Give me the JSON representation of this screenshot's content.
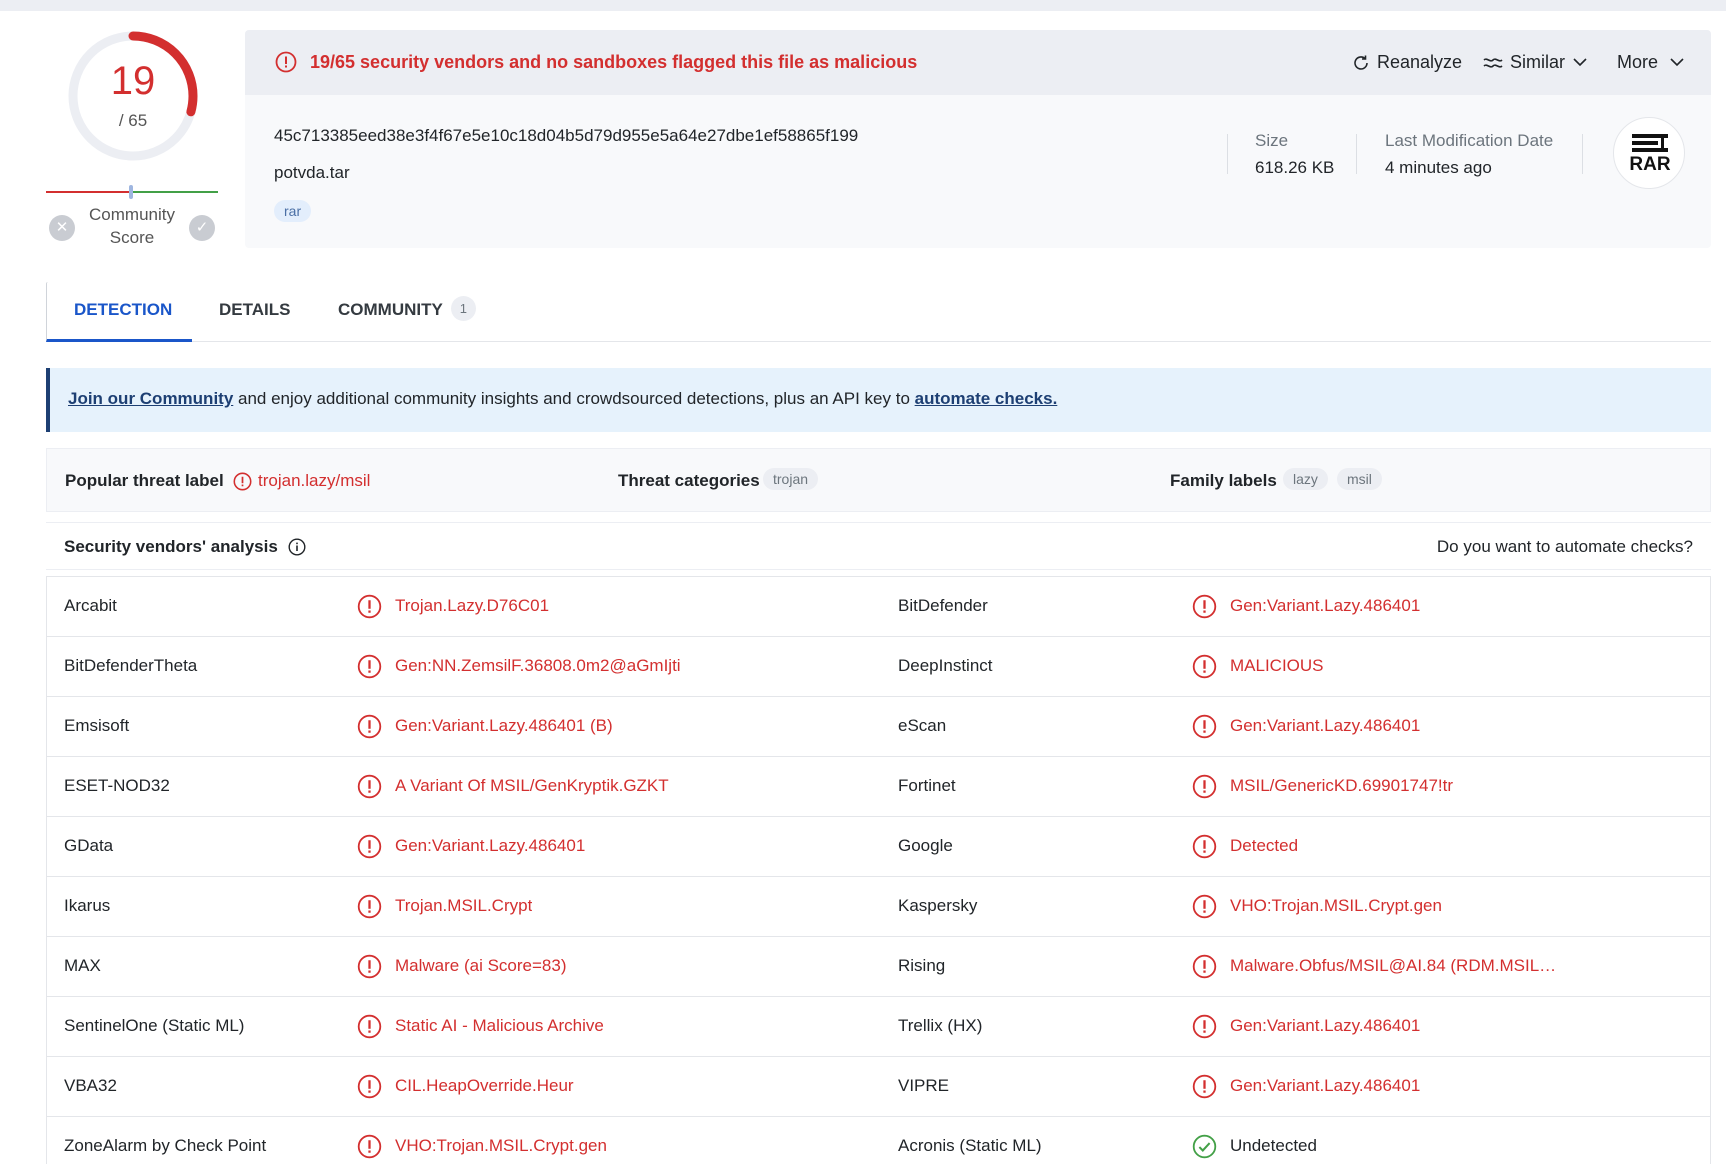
{
  "score": {
    "detections": "19",
    "total": "/ 65",
    "community_label": "Community Score"
  },
  "header": {
    "alert": "19/65 security vendors and no sandboxes flagged this file as malicious",
    "actions": {
      "reanalyze": "Reanalyze",
      "similar": "Similar",
      "more": "More"
    },
    "hash": "45c713385eed38e3f4f67e5e10c18d04b5d79d955e5a64e27dbe1ef58865f199",
    "filename": "potvda.tar",
    "tag": "rar",
    "size_label": "Size",
    "size_value": "618.26 KB",
    "mod_label": "Last Modification Date",
    "mod_value": "4 minutes ago",
    "filetype_icon": "RAR"
  },
  "tabs": {
    "detection": "DETECTION",
    "details": "DETAILS",
    "community": "COMMUNITY",
    "community_count": "1"
  },
  "banner": {
    "link1": "Join our Community",
    "middle": " and enjoy additional community insights and crowdsourced detections, plus an API key to ",
    "link2": "automate checks."
  },
  "threat": {
    "popular_label": "Popular threat label",
    "popular_value": "trojan.lazy/msil",
    "categories_label": "Threat categories",
    "categories": [
      "trojan"
    ],
    "family_label": "Family labels",
    "families": [
      "lazy",
      "msil"
    ]
  },
  "vendors": {
    "title": "Security vendors' analysis",
    "automate": "Do you want to automate checks?",
    "rows": [
      {
        "left_name": "Arcabit",
        "left_result": "Trojan.Lazy.D76C01",
        "left_status": "malicious",
        "right_name": "BitDefender",
        "right_result": "Gen:Variant.Lazy.486401",
        "right_status": "malicious"
      },
      {
        "left_name": "BitDefenderTheta",
        "left_result": "Gen:NN.ZemsilF.36808.0m2@aGmIjti",
        "left_status": "malicious",
        "right_name": "DeepInstinct",
        "right_result": "MALICIOUS",
        "right_status": "malicious"
      },
      {
        "left_name": "Emsisoft",
        "left_result": "Gen:Variant.Lazy.486401 (B)",
        "left_status": "malicious",
        "right_name": "eScan",
        "right_result": "Gen:Variant.Lazy.486401",
        "right_status": "malicious"
      },
      {
        "left_name": "ESET-NOD32",
        "left_result": "A Variant Of MSIL/GenKryptik.GZKT",
        "left_status": "malicious",
        "right_name": "Fortinet",
        "right_result": "MSIL/GenericKD.69901747!tr",
        "right_status": "malicious"
      },
      {
        "left_name": "GData",
        "left_result": "Gen:Variant.Lazy.486401",
        "left_status": "malicious",
        "right_name": "Google",
        "right_result": "Detected",
        "right_status": "malicious"
      },
      {
        "left_name": "Ikarus",
        "left_result": "Trojan.MSIL.Crypt",
        "left_status": "malicious",
        "right_name": "Kaspersky",
        "right_result": "VHO:Trojan.MSIL.Crypt.gen",
        "right_status": "malicious"
      },
      {
        "left_name": "MAX",
        "left_result": "Malware (ai Score=83)",
        "left_status": "malicious",
        "right_name": "Rising",
        "right_result": "Malware.Obfus/MSIL@AI.84 (RDM.MSIL2…",
        "right_status": "malicious"
      },
      {
        "left_name": "SentinelOne (Static ML)",
        "left_result": "Static AI - Malicious Archive",
        "left_status": "malicious",
        "right_name": "Trellix (HX)",
        "right_result": "Gen:Variant.Lazy.486401",
        "right_status": "malicious"
      },
      {
        "left_name": "VBA32",
        "left_result": "CIL.HeapOverride.Heur",
        "left_status": "malicious",
        "right_name": "VIPRE",
        "right_result": "Gen:Variant.Lazy.486401",
        "right_status": "malicious"
      },
      {
        "left_name": "ZoneAlarm by Check Point",
        "left_result": "VHO:Trojan.MSIL.Crypt.gen",
        "left_status": "malicious",
        "right_name": "Acronis (Static ML)",
        "right_result": "Undetected",
        "right_status": "undetected"
      }
    ]
  },
  "colors": {
    "malicious": "#d32f2f",
    "undetected": "#43a047",
    "accent": "#1a56c9"
  }
}
